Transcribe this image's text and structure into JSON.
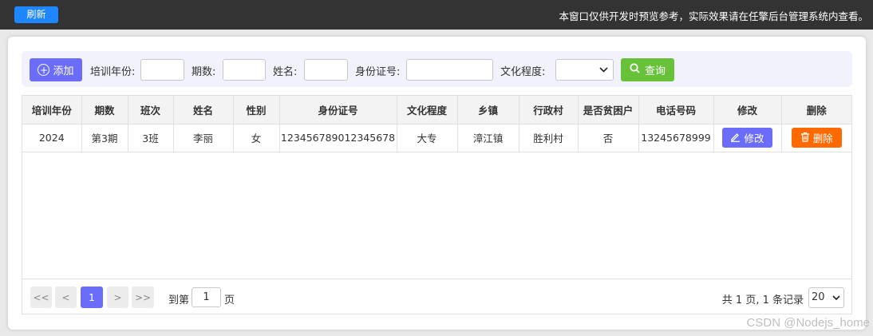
{
  "topbar": {
    "refresh_label": "刷新",
    "notice": "本窗口仅供开发时预览参考，实际效果请在任擎后台管理系统内查看。"
  },
  "search": {
    "add_label": "添加",
    "year_label": "培训年份:",
    "period_label": "期数:",
    "name_label": "姓名:",
    "id_label": "身份证号:",
    "edu_label": "文化程度:",
    "query_label": "查询"
  },
  "table": {
    "headers": [
      "培训年份",
      "期数",
      "班次",
      "姓名",
      "性别",
      "身份证号",
      "文化程度",
      "乡镇",
      "行政村",
      "是否贫困户",
      "电话号码",
      "修改",
      "删除"
    ],
    "rows": [
      {
        "year": "2024",
        "period": "第3期",
        "class": "3班",
        "name": "李丽",
        "gender": "女",
        "id": "123456789012345678",
        "edu": "大专",
        "town": "漳江镇",
        "village": "胜利村",
        "poor": "否",
        "phone": "13245678999",
        "edit_label": "修改",
        "delete_label": "删除"
      }
    ]
  },
  "pager": {
    "first": "<<",
    "prev": "<",
    "current": "1",
    "next": ">",
    "last": ">>",
    "goto_prefix": "到第",
    "goto_value": "1",
    "goto_suffix": "页",
    "summary": "共 1 页, 1 条记录",
    "page_size": "20"
  },
  "watermark": "CSDN @Nodejs_home",
  "colors": {
    "topbar": "#333333",
    "primary": "#6b6dfa",
    "refresh": "#1e86ff",
    "query": "#67c23a",
    "delete": "#ff6a00"
  }
}
